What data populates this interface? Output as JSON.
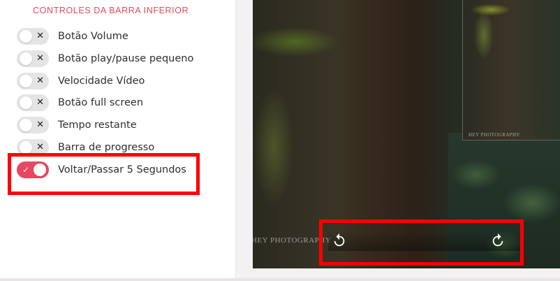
{
  "section": {
    "title": "CONTROLES DA BARRA INFERIOR"
  },
  "toggles": [
    {
      "label": "Botão Volume",
      "state": "off",
      "mark": "✕"
    },
    {
      "label": "Botão play/pause pequeno",
      "state": "off",
      "mark": "✕"
    },
    {
      "label": "Velocidade Vídeo",
      "state": "off",
      "mark": "✕"
    },
    {
      "label": "Botão full screen",
      "state": "off",
      "mark": "✕"
    },
    {
      "label": "Tempo restante",
      "state": "off",
      "mark": "✕"
    },
    {
      "label": "Barra de progresso",
      "state": "off",
      "mark": "✕"
    },
    {
      "label": "Voltar/Passar 5 Segundos",
      "state": "on",
      "mark": "✓"
    }
  ],
  "video": {
    "credit": "HEY PHOTOGRAPHY",
    "inset_credit": "HEY PHOTOGRAPHY",
    "controls": {
      "rewind_icon": "rewind-5-icon",
      "forward_icon": "forward-5-icon"
    }
  },
  "colors": {
    "accent": "#e8485f",
    "highlight": "#ff0000",
    "toggle_off": "#e4e4e4"
  }
}
